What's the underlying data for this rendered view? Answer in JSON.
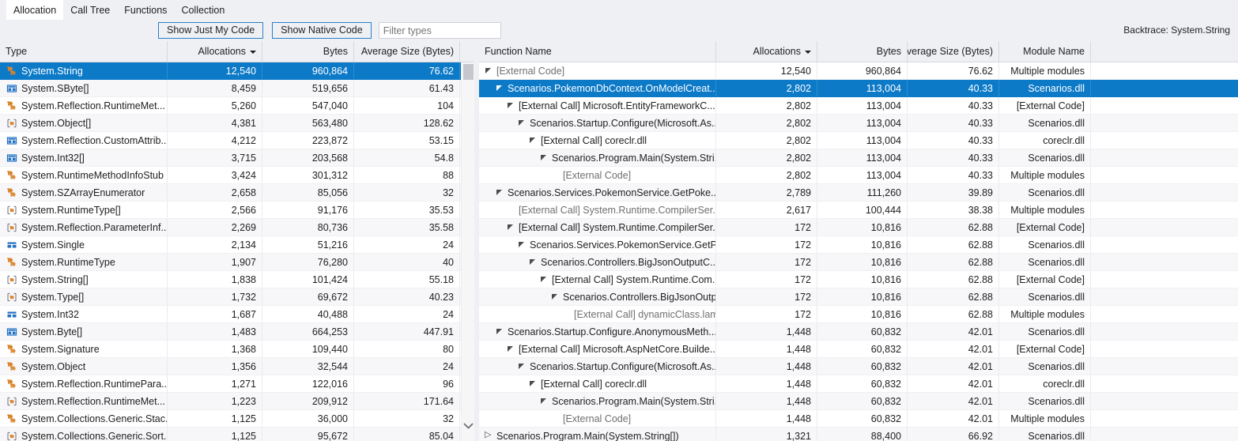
{
  "tabs": [
    {
      "label": "Allocation",
      "selected": true
    },
    {
      "label": "Call Tree",
      "selected": false
    },
    {
      "label": "Functions",
      "selected": false
    },
    {
      "label": "Collection",
      "selected": false
    }
  ],
  "toolbar": {
    "show_just_my_code": "Show Just My Code",
    "show_native_code": "Show Native Code",
    "filter_placeholder": "Filter types",
    "filter_value": "",
    "backtrace_label": "Backtrace: System.String"
  },
  "colors": {
    "selection": "#0d7ac8",
    "toolbar_bg": "#eff0f4",
    "button_border": "#2a7fc9",
    "icon_class": "#d9832b",
    "icon_struct": "#1f6fc4",
    "icon_array": "#7a7a86"
  },
  "left_grid": {
    "columns": [
      {
        "label": "Type",
        "align": "left",
        "sorted": false
      },
      {
        "label": "Allocations",
        "align": "right",
        "sorted": true
      },
      {
        "label": "Bytes",
        "align": "right",
        "sorted": false
      },
      {
        "label": "Average Size (Bytes)",
        "align": "right",
        "sorted": false
      }
    ],
    "rows": [
      {
        "icon": "class-icon",
        "type": "System.String",
        "allocations": "12,540",
        "bytes": "960,864",
        "average": "76.62",
        "selected": true
      },
      {
        "icon": "struct-icon",
        "type": "System.SByte[]",
        "allocations": "8,459",
        "bytes": "519,656",
        "average": "61.43",
        "selected": false
      },
      {
        "icon": "class-icon",
        "type": "System.Reflection.RuntimeMet...",
        "allocations": "5,260",
        "bytes": "547,040",
        "average": "104",
        "selected": false
      },
      {
        "icon": "array-icon",
        "type": "System.Object[]",
        "allocations": "4,381",
        "bytes": "563,480",
        "average": "128.62",
        "selected": false
      },
      {
        "icon": "struct-icon",
        "type": "System.Reflection.CustomAttrib...",
        "allocations": "4,212",
        "bytes": "223,872",
        "average": "53.15",
        "selected": false
      },
      {
        "icon": "struct-icon",
        "type": "System.Int32[]",
        "allocations": "3,715",
        "bytes": "203,568",
        "average": "54.8",
        "selected": false
      },
      {
        "icon": "class-icon",
        "type": "System.RuntimeMethodInfoStub",
        "allocations": "3,424",
        "bytes": "301,312",
        "average": "88",
        "selected": false
      },
      {
        "icon": "class-icon",
        "type": "System.SZArrayEnumerator",
        "allocations": "2,658",
        "bytes": "85,056",
        "average": "32",
        "selected": false
      },
      {
        "icon": "array-icon",
        "type": "System.RuntimeType[]",
        "allocations": "2,566",
        "bytes": "91,176",
        "average": "35.53",
        "selected": false
      },
      {
        "icon": "array-icon",
        "type": "System.Reflection.ParameterInf...",
        "allocations": "2,269",
        "bytes": "80,736",
        "average": "35.58",
        "selected": false
      },
      {
        "icon": "value-icon",
        "type": "System.Single",
        "allocations": "2,134",
        "bytes": "51,216",
        "average": "24",
        "selected": false
      },
      {
        "icon": "class-icon",
        "type": "System.RuntimeType",
        "allocations": "1,907",
        "bytes": "76,280",
        "average": "40",
        "selected": false
      },
      {
        "icon": "array-icon",
        "type": "System.String[]",
        "allocations": "1,838",
        "bytes": "101,424",
        "average": "55.18",
        "selected": false
      },
      {
        "icon": "array-icon",
        "type": "System.Type[]",
        "allocations": "1,732",
        "bytes": "69,672",
        "average": "40.23",
        "selected": false
      },
      {
        "icon": "value-icon",
        "type": "System.Int32",
        "allocations": "1,687",
        "bytes": "40,488",
        "average": "24",
        "selected": false
      },
      {
        "icon": "struct-icon",
        "type": "System.Byte[]",
        "allocations": "1,483",
        "bytes": "664,253",
        "average": "447.91",
        "selected": false
      },
      {
        "icon": "class-icon",
        "type": "System.Signature",
        "allocations": "1,368",
        "bytes": "109,440",
        "average": "80",
        "selected": false
      },
      {
        "icon": "class-icon",
        "type": "System.Object",
        "allocations": "1,356",
        "bytes": "32,544",
        "average": "24",
        "selected": false
      },
      {
        "icon": "class-icon",
        "type": "System.Reflection.RuntimePara...",
        "allocations": "1,271",
        "bytes": "122,016",
        "average": "96",
        "selected": false
      },
      {
        "icon": "array-icon",
        "type": "System.Reflection.RuntimeMet...",
        "allocations": "1,223",
        "bytes": "209,912",
        "average": "171.64",
        "selected": false
      },
      {
        "icon": "class-icon",
        "type": "System.Collections.Generic.Stac...",
        "allocations": "1,125",
        "bytes": "36,000",
        "average": "32",
        "selected": false
      },
      {
        "icon": "array-icon",
        "type": "System.Collections.Generic.Sort...",
        "allocations": "1,125",
        "bytes": "95,672",
        "average": "85.04",
        "selected": false
      }
    ]
  },
  "right_grid": {
    "columns": [
      {
        "label": "Function Name",
        "align": "left",
        "sorted": false
      },
      {
        "label": "Allocations",
        "align": "right",
        "sorted": true
      },
      {
        "label": "Bytes",
        "align": "right",
        "sorted": false
      },
      {
        "label": "Average Size (Bytes)",
        "align": "right",
        "sorted": false
      },
      {
        "label": "Module Name",
        "align": "right",
        "sorted": false
      }
    ],
    "rows": [
      {
        "indent": 0,
        "expander": "expanded",
        "function": "[External Code]",
        "dim": true,
        "allocations": "12,540",
        "bytes": "960,864",
        "average": "76.62",
        "module": "Multiple modules",
        "selected": false
      },
      {
        "indent": 1,
        "expander": "expanded",
        "function": "Scenarios.PokemonDbContext.OnModelCreat...",
        "dim": false,
        "allocations": "2,802",
        "bytes": "113,004",
        "average": "40.33",
        "module": "Scenarios.dll",
        "selected": true
      },
      {
        "indent": 2,
        "expander": "expanded",
        "function": "[External Call] Microsoft.EntityFrameworkC...",
        "dim": false,
        "allocations": "2,802",
        "bytes": "113,004",
        "average": "40.33",
        "module": "[External Code]",
        "selected": false
      },
      {
        "indent": 3,
        "expander": "expanded",
        "function": "Scenarios.Startup.Configure(Microsoft.As...",
        "dim": false,
        "allocations": "2,802",
        "bytes": "113,004",
        "average": "40.33",
        "module": "Scenarios.dll",
        "selected": false
      },
      {
        "indent": 4,
        "expander": "expanded",
        "function": "[External Call] coreclr.dll",
        "dim": false,
        "allocations": "2,802",
        "bytes": "113,004",
        "average": "40.33",
        "module": "coreclr.dll",
        "selected": false
      },
      {
        "indent": 5,
        "expander": "expanded",
        "function": "Scenarios.Program.Main(System.Stri...",
        "dim": false,
        "allocations": "2,802",
        "bytes": "113,004",
        "average": "40.33",
        "module": "Scenarios.dll",
        "selected": false
      },
      {
        "indent": 6,
        "expander": "none",
        "function": "[External Code]",
        "dim": true,
        "allocations": "2,802",
        "bytes": "113,004",
        "average": "40.33",
        "module": "Multiple modules",
        "selected": false
      },
      {
        "indent": 1,
        "expander": "expanded",
        "function": "Scenarios.Services.PokemonService.GetPoke...",
        "dim": false,
        "allocations": "2,789",
        "bytes": "111,260",
        "average": "39.89",
        "module": "Scenarios.dll",
        "selected": false
      },
      {
        "indent": 2,
        "expander": "none",
        "function": "[External Call] System.Runtime.CompilerSer...",
        "dim": true,
        "allocations": "2,617",
        "bytes": "100,444",
        "average": "38.38",
        "module": "Multiple modules",
        "selected": false
      },
      {
        "indent": 2,
        "expander": "expanded",
        "function": "[External Call] System.Runtime.CompilerSer...",
        "dim": false,
        "allocations": "172",
        "bytes": "10,816",
        "average": "62.88",
        "module": "[External Code]",
        "selected": false
      },
      {
        "indent": 3,
        "expander": "expanded",
        "function": "Scenarios.Services.PokemonService.GetP...",
        "dim": false,
        "allocations": "172",
        "bytes": "10,816",
        "average": "62.88",
        "module": "Scenarios.dll",
        "selected": false
      },
      {
        "indent": 4,
        "expander": "expanded",
        "function": "Scenarios.Controllers.BigJsonOutputC...",
        "dim": false,
        "allocations": "172",
        "bytes": "10,816",
        "average": "62.88",
        "module": "Scenarios.dll",
        "selected": false
      },
      {
        "indent": 5,
        "expander": "expanded",
        "function": "[External Call] System.Runtime.Com...",
        "dim": false,
        "allocations": "172",
        "bytes": "10,816",
        "average": "62.88",
        "module": "[External Code]",
        "selected": false
      },
      {
        "indent": 6,
        "expander": "expanded",
        "function": "Scenarios.Controllers.BigJsonOutp...",
        "dim": false,
        "allocations": "172",
        "bytes": "10,816",
        "average": "62.88",
        "module": "Scenarios.dll",
        "selected": false
      },
      {
        "indent": 7,
        "expander": "none",
        "function": "[External Call] dynamicClass.lam...",
        "dim": true,
        "allocations": "172",
        "bytes": "10,816",
        "average": "62.88",
        "module": "Multiple modules",
        "selected": false
      },
      {
        "indent": 1,
        "expander": "expanded",
        "function": "Scenarios.Startup.Configure.AnonymousMeth...",
        "dim": false,
        "allocations": "1,448",
        "bytes": "60,832",
        "average": "42.01",
        "module": "Scenarios.dll",
        "selected": false
      },
      {
        "indent": 2,
        "expander": "expanded",
        "function": "[External Call] Microsoft.AspNetCore.Builde...",
        "dim": false,
        "allocations": "1,448",
        "bytes": "60,832",
        "average": "42.01",
        "module": "[External Code]",
        "selected": false
      },
      {
        "indent": 3,
        "expander": "expanded",
        "function": "Scenarios.Startup.Configure(Microsoft.As...",
        "dim": false,
        "allocations": "1,448",
        "bytes": "60,832",
        "average": "42.01",
        "module": "Scenarios.dll",
        "selected": false
      },
      {
        "indent": 4,
        "expander": "expanded",
        "function": "[External Call] coreclr.dll",
        "dim": false,
        "allocations": "1,448",
        "bytes": "60,832",
        "average": "42.01",
        "module": "coreclr.dll",
        "selected": false
      },
      {
        "indent": 5,
        "expander": "expanded",
        "function": "Scenarios.Program.Main(System.Stri...",
        "dim": false,
        "allocations": "1,448",
        "bytes": "60,832",
        "average": "42.01",
        "module": "Scenarios.dll",
        "selected": false
      },
      {
        "indent": 6,
        "expander": "none",
        "function": "[External Code]",
        "dim": true,
        "allocations": "1,448",
        "bytes": "60,832",
        "average": "42.01",
        "module": "Multiple modules",
        "selected": false
      },
      {
        "indent": 0,
        "expander": "collapsed",
        "function": "Scenarios.Program.Main(System.String[])",
        "dim": false,
        "allocations": "1,321",
        "bytes": "88,400",
        "average": "66.92",
        "module": "Scenarios.dll",
        "selected": false
      }
    ]
  }
}
